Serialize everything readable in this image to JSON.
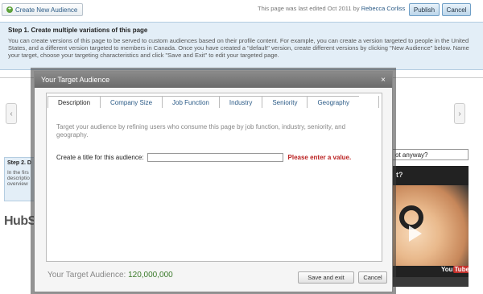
{
  "topbar": {
    "create_label": "Create New Audience",
    "edited_text": "This page was last edited Oct 2011 by",
    "edited_author": "Rebecca Corliss",
    "publish_label": "Publish",
    "cancel_label": "Cancel"
  },
  "step1": {
    "title": "Step 1. Create multiple variations of this page",
    "body": "You can create versions of this page to be served to custom audiences based on their profile content. For example, you can create a version targeted to people in the United States, and a different version targeted to members in Canada. Once you have created a \"default\" version, create different versions by clicking \"New Audience\" below. Name your target, choose your targeting characteristics and click \"Save and Exit\" to edit your targeted page."
  },
  "background": {
    "step2_title": "Step 2. D",
    "step2_body": "In the firs descriptio overview",
    "brand": "HubSp",
    "search_value": "ot anyway?",
    "video_title": "t?",
    "youtube_you": "You",
    "youtube_tube": "Tube"
  },
  "modal": {
    "title": "Your Target Audience",
    "close": "×",
    "tabs": [
      {
        "label": "Description",
        "active": true
      },
      {
        "label": "Company Size"
      },
      {
        "label": "Job Function"
      },
      {
        "label": "Industry"
      },
      {
        "label": "Seniority"
      },
      {
        "label": "Geography"
      }
    ],
    "description": "Target your audience by refining users who consume this page by job function, industry, seniority, and geography.",
    "title_label": "Create a title for this audience:",
    "title_value": "",
    "title_error": "Please enter a value.",
    "audience_label": "Your Target Audience:",
    "audience_count": "120,000,000",
    "save_label": "Save and exit",
    "cancel_label": "Cancel"
  },
  "colors": {
    "accent_blue": "#2a5a86",
    "error_red": "#b22222",
    "count_green": "#3a7a2a",
    "step_bg": "#e3eef7"
  },
  "icons": {
    "create": "plus-circle-icon",
    "nav_left": "chevron-left-icon",
    "nav_right": "chevron-right-icon",
    "close": "close-icon",
    "play": "play-icon"
  }
}
